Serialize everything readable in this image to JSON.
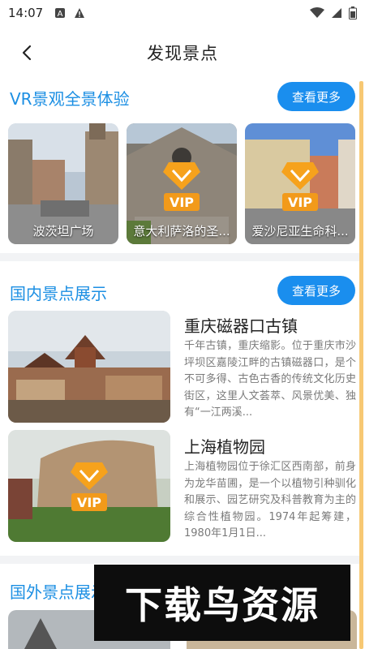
{
  "status_bar": {
    "time": "14:07"
  },
  "header": {
    "title": "发现景点"
  },
  "vr_section": {
    "title": "VR景观全景体验",
    "more_label": "查看更多",
    "items": [
      {
        "label": "波茨坦广场"
      },
      {
        "label": "意大利萨洛的圣..."
      },
      {
        "label": "爱沙尼亚生命科..."
      }
    ]
  },
  "domestic_section": {
    "title": "国内景点展示",
    "more_label": "查看更多",
    "items": [
      {
        "title": "重庆磁器口古镇",
        "description": "千年古镇，重庆缩影。位于重庆市沙坪坝区嘉陵江畔的古镇磁器口，是个不可多得、古色古香的传统文化历史街区，这里人文荟萃、风景优美、独有“一江两溪..."
      },
      {
        "title": "上海植物园",
        "description": "上海植物园位于徐汇区西南部，前身为龙华苗圃，是一个以植物引种驯化和展示、园艺研究及科普教育为主的综合性植物园。1974年起筹建，1980年1月1日..."
      }
    ]
  },
  "overseas_section": {
    "title": "国外景点展示"
  },
  "vip_badge_text": "VIP",
  "watermark": {
    "text": "下载鸟资源"
  },
  "colors": {
    "accent_blue": "#1a8eee",
    "title_blue": "#1c8fe3",
    "vip_orange": "#f29a1a"
  }
}
